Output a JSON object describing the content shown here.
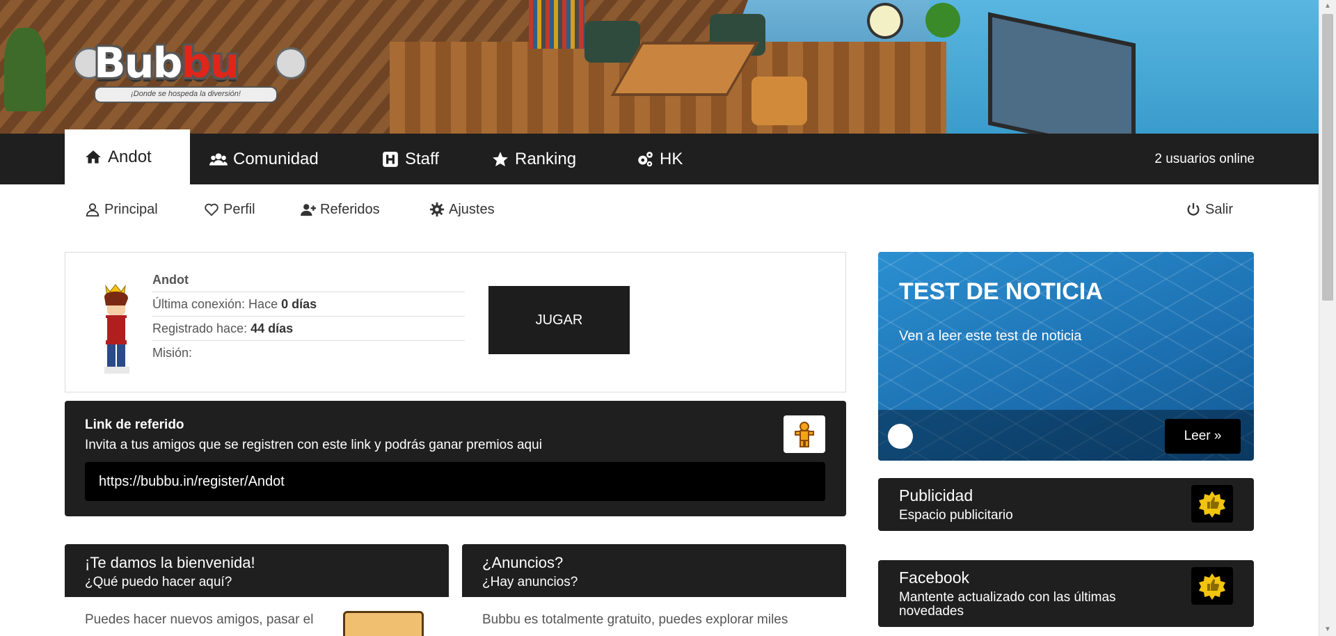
{
  "logo": {
    "text_white": "Bub",
    "text_red": "bu",
    "tagline": "¡Donde se hospeda la diversión!"
  },
  "nav": {
    "items": [
      {
        "label": "Andot",
        "icon": "home-icon"
      },
      {
        "label": "Comunidad",
        "icon": "users-icon"
      },
      {
        "label": "Staff",
        "icon": "h-square-icon"
      },
      {
        "label": "Ranking",
        "icon": "star-icon"
      },
      {
        "label": "HK",
        "icon": "cogs-icon"
      }
    ],
    "online": "2 usuarios online"
  },
  "subnav": {
    "items": [
      {
        "label": "Principal",
        "icon": "user-icon"
      },
      {
        "label": "Perfil",
        "icon": "heart-icon"
      },
      {
        "label": "Referidos",
        "icon": "user-plus-icon"
      },
      {
        "label": "Ajustes",
        "icon": "gear-icon"
      }
    ],
    "logout": "Salir"
  },
  "profile": {
    "name": "Andot",
    "last_login_label": "Última conexión: Hace ",
    "last_login_value": "0 días",
    "registered_label": "Registrado hace: ",
    "registered_value": "44 días",
    "mission_label": "Misión:",
    "play_label": "JUGAR"
  },
  "referral": {
    "title": "Link de referido",
    "description": "Invita a tus amigos que se registren con este link y podrás ganar premios aqui",
    "link": "https://bubbu.in/register/Andot"
  },
  "welcome_card": {
    "title": "¡Te damos la bienvenida!",
    "subtitle": "¿Qué puedo hacer aquí?",
    "body": "Puedes hacer nuevos amigos, pasar el"
  },
  "ads_card": {
    "title": "¿Anuncios?",
    "subtitle": "¿Hay anuncios?",
    "body": "Bubbu es totalmente gratuito, puedes explorar miles"
  },
  "news": {
    "title": "TEST DE NOTICIA",
    "subtitle": "Ven a leer este test de noticia",
    "read_label": "Leer »"
  },
  "publicidad": {
    "title": "Publicidad",
    "subtitle": "Espacio publicitario"
  },
  "facebook": {
    "title": "Facebook",
    "subtitle": "Mantente actualizado con las últimas novedades"
  },
  "colors": {
    "nav_bg": "#1f1f1f",
    "news_blue": "#1c6fb0",
    "badge_yellow": "#f2c40f"
  }
}
